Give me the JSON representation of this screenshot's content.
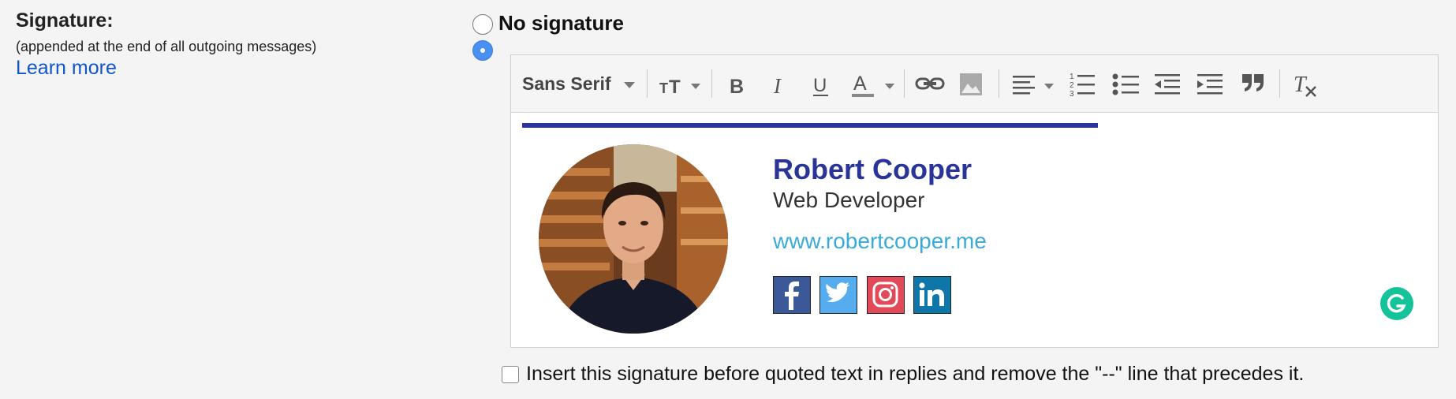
{
  "signature": {
    "title": "Signature:",
    "subtitle": "(appended at the end of all outgoing messages)",
    "learn_more": "Learn more"
  },
  "options": {
    "no_signature": "No signature",
    "selected": "custom"
  },
  "toolbar": {
    "font": "Sans Serif",
    "buttons": [
      "font-size-icon",
      "bold-icon",
      "italic-icon",
      "underline-icon",
      "text-color-icon",
      "link-icon",
      "image-icon",
      "align-icon",
      "numbered-list-icon",
      "bulleted-list-icon",
      "indent-less-icon",
      "indent-more-icon",
      "quote-icon",
      "remove-formatting-icon"
    ]
  },
  "card": {
    "name": "Robert Cooper",
    "role": "Web Developer",
    "website": "www.robertcooper.me",
    "accent_color": "#2a3397",
    "link_color": "#3aabd8",
    "social": [
      "facebook-icon",
      "twitter-icon",
      "instagram-icon",
      "linkedin-icon"
    ]
  },
  "checkbox": {
    "label": "Insert this signature before quoted text in replies and remove the \"--\" line that precedes it.",
    "checked": false
  }
}
